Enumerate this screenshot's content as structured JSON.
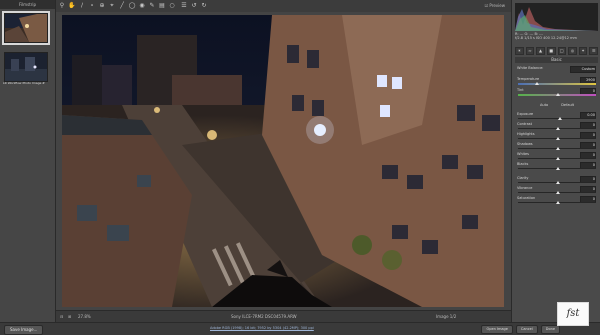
{
  "filmstrip": {
    "title": "Filmstrip",
    "items": [
      {
        "caption": "DSC04579.ARW",
        "selected": true
      },
      {
        "caption": "LR Workflow Photo Image #",
        "selected": false
      }
    ]
  },
  "toolbar": {
    "tools": [
      "zoom-icon",
      "hand-icon",
      "white-balance-icon",
      "color-sampler-icon",
      "target-adjust-icon",
      "crop-icon",
      "straighten-icon",
      "spot-removal-icon",
      "red-eye-icon",
      "adjustment-brush-icon",
      "graduated-filter-icon",
      "radial-filter-icon",
      "preferences-icon",
      "rotate-left-icon",
      "rotate-right-icon"
    ],
    "preview_label": "Preview"
  },
  "statusbar": {
    "zoom": "27.8%",
    "camera_info": "Sony ILCE-7RM2  DSC04579.ARW",
    "workflow_info": "Adobe RGB (1998); 16 bit; 7952 by 5304 (42.2MP); 300 ppi",
    "image_count": "Image 1/2"
  },
  "histogram": {
    "rgb": {
      "r": "R: ---",
      "g": "G: ---",
      "b": "B: ---"
    },
    "exposure_info": "f/2.8  1/15 s  ISO 400  12-24@12 mm"
  },
  "panel": {
    "section_title": "Basic",
    "white_balance_label": "White Balance:",
    "white_balance_value": "Custom",
    "auto_label": "Auto",
    "default_label": "Default",
    "sliders": [
      {
        "name": "Temperature",
        "value": "2900",
        "pos": 0.22,
        "type": "temp"
      },
      {
        "name": "Tint",
        "value": "0",
        "pos": 0.5,
        "type": "tint"
      },
      {
        "name": "Exposure",
        "value": "0.00",
        "pos": 0.52,
        "type": "normal"
      },
      {
        "name": "Contrast",
        "value": "0",
        "pos": 0.5,
        "type": "normal"
      },
      {
        "name": "Highlights",
        "value": "0",
        "pos": 0.5,
        "type": "normal"
      },
      {
        "name": "Shadows",
        "value": "0",
        "pos": 0.5,
        "type": "normal"
      },
      {
        "name": "Whites",
        "value": "0",
        "pos": 0.5,
        "type": "normal"
      },
      {
        "name": "Blacks",
        "value": "0",
        "pos": 0.5,
        "type": "normal"
      },
      {
        "name": "Clarity",
        "value": "0",
        "pos": 0.5,
        "type": "normal"
      },
      {
        "name": "Vibrance",
        "value": "0",
        "pos": 0.5,
        "type": "normal"
      },
      {
        "name": "Saturation",
        "value": "0",
        "pos": 0.5,
        "type": "normal"
      }
    ]
  },
  "footer": {
    "save_label": "Save Image...",
    "workflow_link": "Adobe RGB (1998); 16 bit; 7952 by 5304 (42.2MP); 300 ppi",
    "open_label": "Open Image",
    "cancel_label": "Cancel",
    "done_label": "Done"
  },
  "watermark": "fst",
  "colors": {
    "accent": "#d7d7d7",
    "panel": "#4a4a4a",
    "background": "#3b3b3b"
  }
}
